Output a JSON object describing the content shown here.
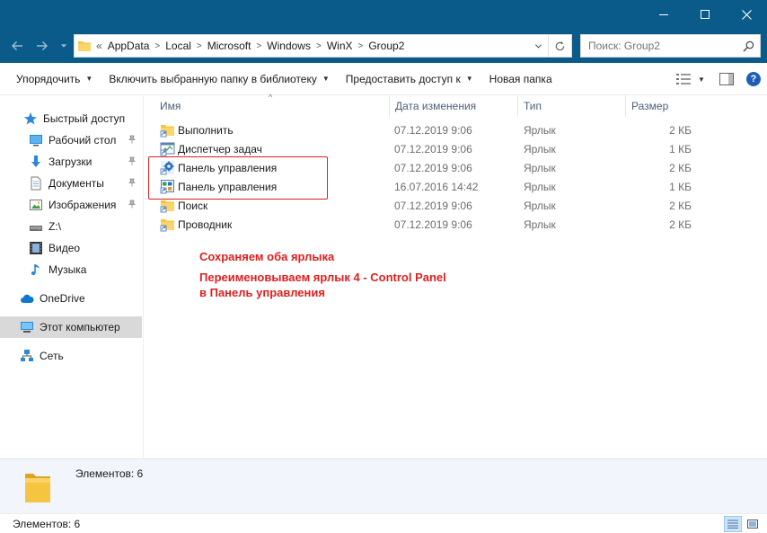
{
  "titlebar": {
    "minimize": "–",
    "maximize": "□",
    "close": "✕"
  },
  "address": {
    "crumbs": [
      "AppData",
      "Local",
      "Microsoft",
      "Windows",
      "WinX",
      "Group2"
    ],
    "lead": "«"
  },
  "search": {
    "placeholder": "Поиск: Group2"
  },
  "toolbar": {
    "organize": "Упорядочить",
    "include_library": "Включить выбранную папку в библиотеку",
    "share": "Предоставить доступ к",
    "new_folder": "Новая папка"
  },
  "sidebar": {
    "items": [
      {
        "label": "Быстрый доступ",
        "icon": "star-icon"
      },
      {
        "label": "Рабочий стол",
        "icon": "desktop-icon",
        "pinned": true
      },
      {
        "label": "Загрузки",
        "icon": "download-icon",
        "pinned": true
      },
      {
        "label": "Документы",
        "icon": "document-icon",
        "pinned": true
      },
      {
        "label": "Изображения",
        "icon": "pictures-icon",
        "pinned": true
      },
      {
        "label": "Z:\\",
        "icon": "drive-icon"
      },
      {
        "label": "Видео",
        "icon": "video-icon"
      },
      {
        "label": "Музыка",
        "icon": "music-icon"
      },
      {
        "label": "OneDrive",
        "icon": "cloud-icon"
      },
      {
        "label": "Этот компьютер",
        "icon": "computer-icon",
        "selected": true
      },
      {
        "label": "Сеть",
        "icon": "network-icon"
      }
    ]
  },
  "columns": {
    "name": "Имя",
    "date": "Дата изменения",
    "type": "Тип",
    "size": "Размер"
  },
  "files": [
    {
      "name": "Выполнить",
      "date": "07.12.2019 9:06",
      "type": "Ярлык",
      "size": "2 КБ",
      "icon": "shortcut-icon"
    },
    {
      "name": "Диспетчер задач",
      "date": "07.12.2019 9:06",
      "type": "Ярлык",
      "size": "1 КБ",
      "icon": "task-manager-icon"
    },
    {
      "name": "Панель управления",
      "date": "07.12.2019 9:06",
      "type": "Ярлык",
      "size": "2 КБ",
      "icon": "control-panel-icon"
    },
    {
      "name": "Панель управления",
      "date": "16.07.2016 14:42",
      "type": "Ярлык",
      "size": "1 КБ",
      "icon": "control-panel-icon"
    },
    {
      "name": "Поиск",
      "date": "07.12.2019 9:06",
      "type": "Ярлык",
      "size": "2 КБ",
      "icon": "shortcut-icon"
    },
    {
      "name": "Проводник",
      "date": "07.12.2019 9:06",
      "type": "Ярлык",
      "size": "2 КБ",
      "icon": "shortcut-icon"
    }
  ],
  "annotations": {
    "line1": "Сохраняем оба ярлыка",
    "line2": "Переименовываем ярлык 4 - Control Panel",
    "line3": "в Панель управления"
  },
  "details": {
    "count": "Элементов: 6"
  },
  "status": {
    "count": "Элементов: 6"
  },
  "colors": {
    "titlebar": "#0b5b8a",
    "annotation": "#e01e1e",
    "selection": "#d9d9d9",
    "folder": "#f5c542"
  }
}
